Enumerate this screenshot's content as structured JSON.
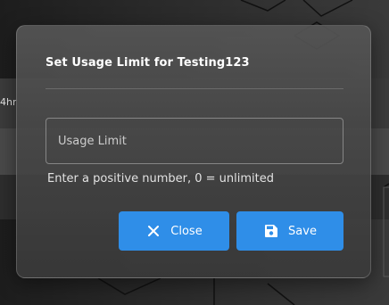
{
  "background": {
    "partial_text": "4hr"
  },
  "dialog": {
    "title": "Set Usage Limit for Testing123",
    "input": {
      "placeholder": "Usage Limit",
      "value": ""
    },
    "helper_text": "Enter a positive number, 0 = unlimited",
    "buttons": {
      "close_label": "Close",
      "save_label": "Save"
    }
  },
  "colors": {
    "primary_button": "#2f8ee8",
    "dialog_background": "#555555",
    "text": "#ffffff"
  },
  "icons": {
    "close": "close-icon",
    "save": "save-icon"
  }
}
